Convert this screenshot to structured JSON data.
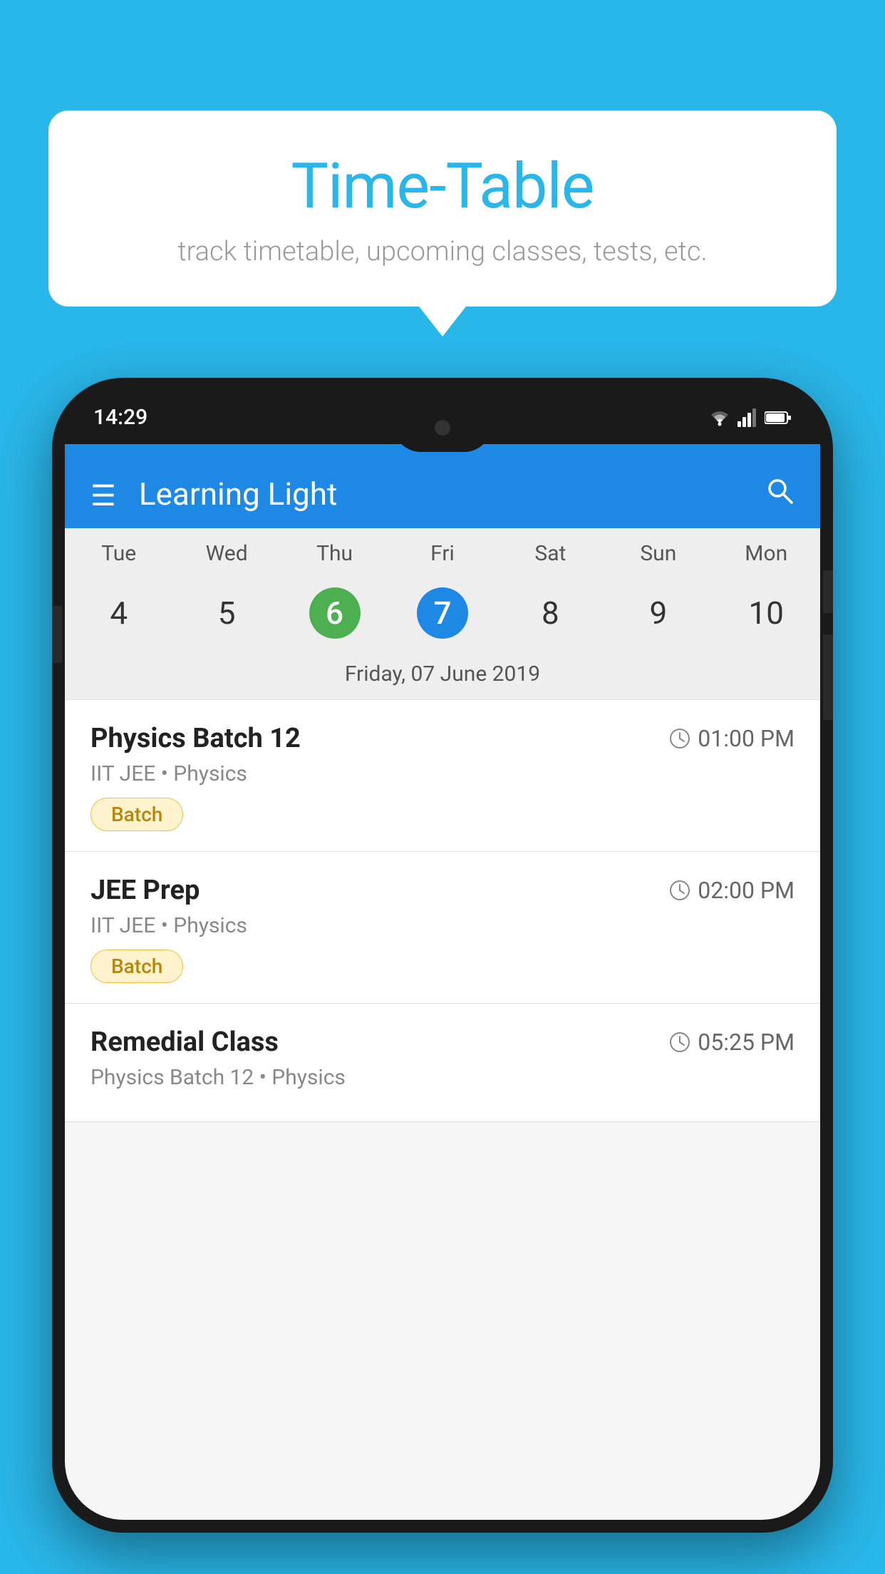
{
  "background_color": "#29B6E8",
  "bubble": {
    "title": "Time-Table",
    "subtitle": "track timetable, upcoming classes, tests, etc."
  },
  "app": {
    "time": "14:29",
    "title": "Learning Light"
  },
  "calendar": {
    "days": [
      {
        "label": "Tue",
        "number": "4"
      },
      {
        "label": "Wed",
        "number": "5"
      },
      {
        "label": "Thu",
        "number": "6",
        "state": "today"
      },
      {
        "label": "Fri",
        "number": "7",
        "state": "selected"
      },
      {
        "label": "Sat",
        "number": "8"
      },
      {
        "label": "Sun",
        "number": "9"
      },
      {
        "label": "Mon",
        "number": "10"
      }
    ],
    "selected_date_label": "Friday, 07 June 2019"
  },
  "schedule": [
    {
      "title": "Physics Batch 12",
      "time": "01:00 PM",
      "subtitle": "IIT JEE • Physics",
      "badge": "Batch"
    },
    {
      "title": "JEE Prep",
      "time": "02:00 PM",
      "subtitle": "IIT JEE • Physics",
      "badge": "Batch"
    },
    {
      "title": "Remedial Class",
      "time": "05:25 PM",
      "subtitle": "Physics Batch 12 • Physics",
      "badge": null
    }
  ]
}
